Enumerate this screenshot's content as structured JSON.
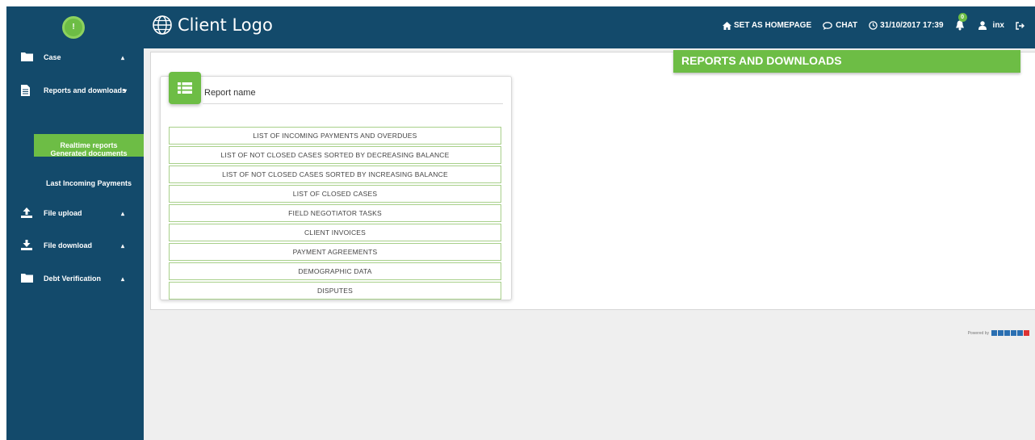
{
  "header": {
    "logo_text": "Client Logo",
    "set_homepage": "SET AS HOMEPAGE",
    "chat": "CHAT",
    "datetime": "31/10/2017 17:39",
    "notifications_count": "0",
    "user": "inx"
  },
  "sidebar": {
    "avatar_letter": "!",
    "items": [
      {
        "label": "Case"
      },
      {
        "label": "Reports and downloads"
      },
      {
        "label": "File upload"
      },
      {
        "label": "File download"
      },
      {
        "label": "Debt Verification"
      }
    ],
    "subitems": [
      {
        "label": "Realtime reports"
      },
      {
        "label": "Generated documents"
      },
      {
        "label": "Last Incoming Payments"
      }
    ]
  },
  "page": {
    "title": "REPORTS AND DOWNLOADS",
    "card_header": "Report name",
    "reports": [
      "LIST OF INCOMING PAYMENTS AND OVERDUES",
      "LIST OF NOT CLOSED CASES SORTED BY DECREASING BALANCE",
      "LIST OF NOT CLOSED CASES SORTED BY INCREASING BALANCE",
      "LIST OF CLOSED CASES",
      "FIELD NEGOTIATOR TASKS",
      "CLIENT INVOICES",
      "PAYMENT AGREEMENTS",
      "DEMOGRAPHIC DATA",
      "DISPUTES"
    ]
  },
  "footer": {
    "powered_by": "Powered by"
  },
  "colors": {
    "navy": "#134a6b",
    "green": "#6dbd45"
  }
}
